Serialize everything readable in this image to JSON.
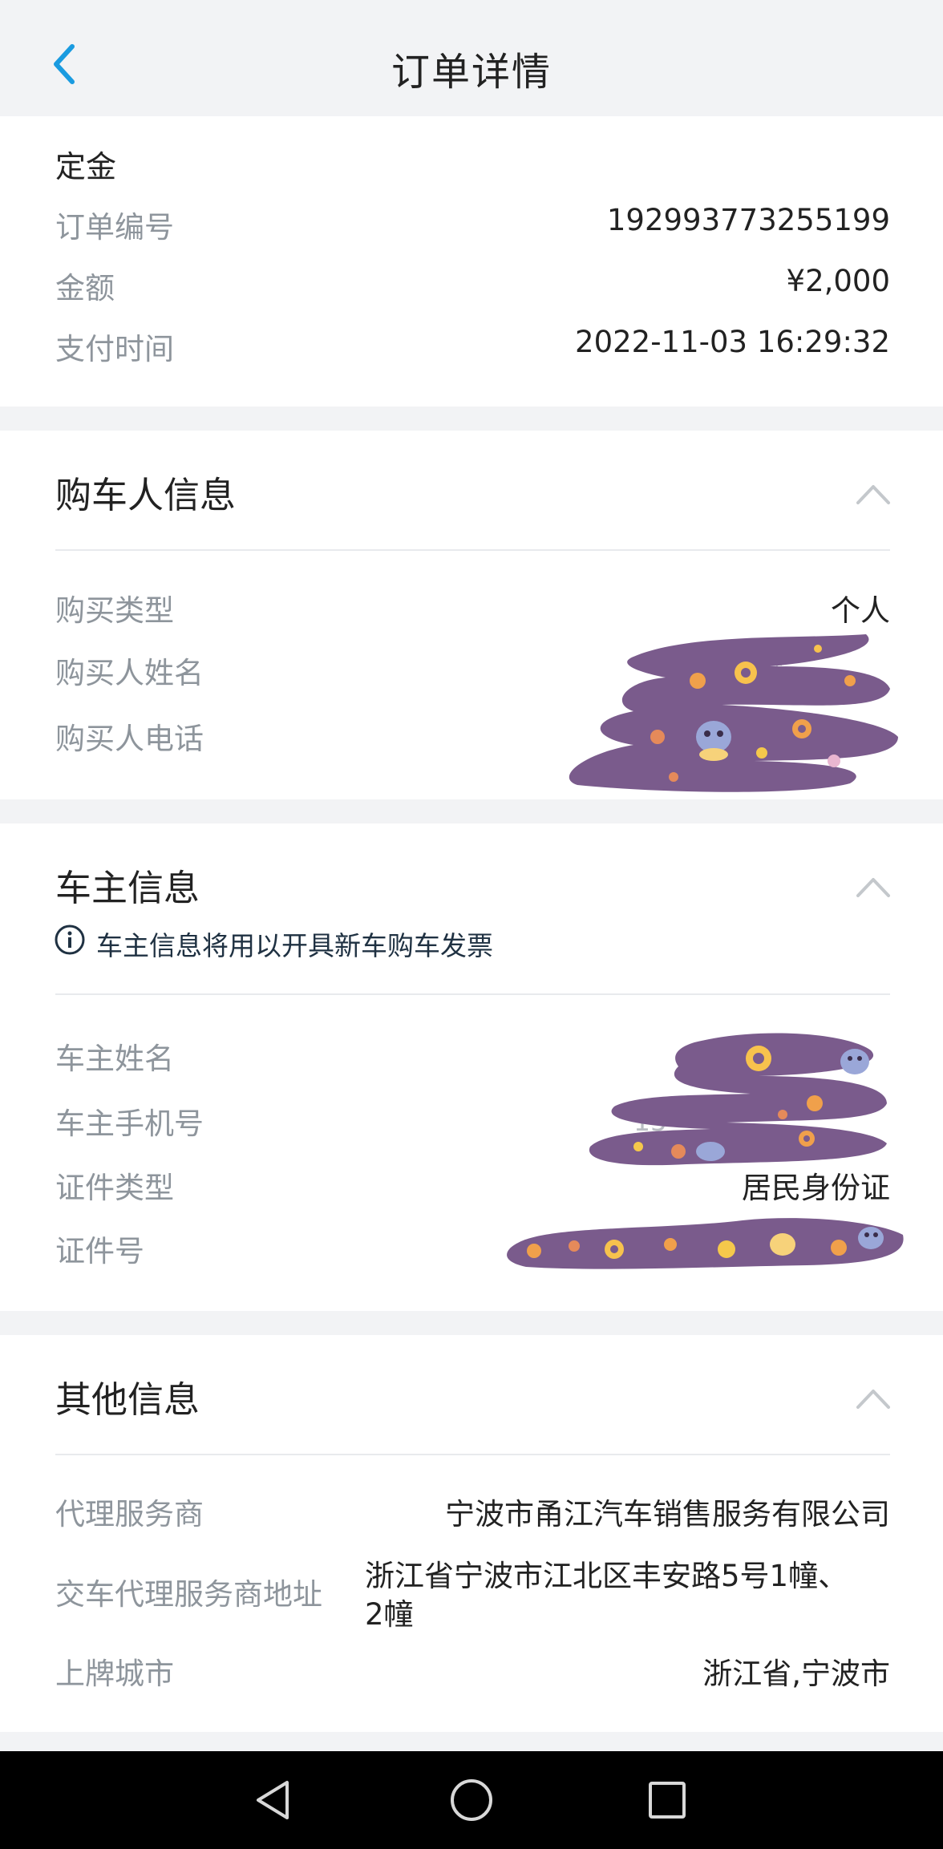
{
  "header": {
    "title": "订单详情"
  },
  "deposit": {
    "title": "定金",
    "rows": [
      {
        "label": "订单编号",
        "value": "192993773255199"
      },
      {
        "label": "金额",
        "value": "¥2,000"
      },
      {
        "label": "支付时间",
        "value": "2022-11-03 16:29:32"
      }
    ]
  },
  "buyer": {
    "title": "购车人信息",
    "rows": [
      {
        "label": "购买类型",
        "value": "个人"
      },
      {
        "label": "购买人姓名",
        "value": ""
      },
      {
        "label": "购买人电话",
        "value": ""
      }
    ],
    "visible_fragment": "**"
  },
  "owner": {
    "title": "车主信息",
    "notice": "车主信息将用以开具新车购车发票",
    "rows": [
      {
        "label": "车主姓名",
        "value": ""
      },
      {
        "label": "车主手机号",
        "value": "15"
      },
      {
        "label": "证件类型",
        "value": "居民身份证"
      },
      {
        "label": "证件号",
        "value": ""
      }
    ]
  },
  "other": {
    "title": "其他信息",
    "rows": [
      {
        "label": "代理服务商",
        "value": "宁波市甬江汽车销售服务有限公司"
      },
      {
        "label": "交车代理服务商地址",
        "value_line1": "浙江省宁波市江北区丰安路5号1幢、",
        "value_line2": "2幢"
      },
      {
        "label": "上牌城市",
        "value": "浙江省,宁波市"
      }
    ]
  },
  "colors": {
    "accent": "#1a9be0",
    "scribble": "#7a5b8c",
    "label": "#8e959c",
    "text": "#222222",
    "notice": "#1f3142"
  },
  "icons": {
    "back": "chevron-left",
    "collapse": "chevron-up",
    "info": "info-circle",
    "nav": [
      "triangle-back",
      "circle-home",
      "square-recents"
    ]
  }
}
